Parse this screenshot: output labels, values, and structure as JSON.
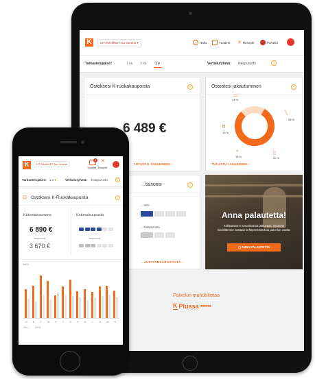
{
  "colors": {
    "brand": "#f26a1b",
    "accent_blue": "#2b4a9e",
    "grey": "#c9c9c9",
    "light_grey": "#e3e3e3"
  },
  "tablet": {
    "nav": {
      "logo": "K",
      "store": "CITYMARKET Iso Omena ▾",
      "items": [
        {
          "label": "Haku",
          "icon": "search-icon"
        },
        {
          "label": "Tuotteet",
          "icon": "cart-icon"
        },
        {
          "label": "Reseptit",
          "icon": "utensils-icon"
        },
        {
          "label": "Palvelut",
          "icon": "services-icon"
        }
      ]
    },
    "period": {
      "label": "Tarkastelujakso:",
      "options": [
        "1 kk",
        "3 kk",
        "1 v"
      ],
      "selected": "1 v",
      "compare_label": "Vertailuryhmä:",
      "compare_value": "Naapurusto"
    },
    "purchases_card": {
      "title": "Ostoksesi K-ruokakaupoista",
      "amount": "6 489 €",
      "link": "TUTUSTU TARKEMMIN"
    },
    "distribution_card": {
      "title": "Ostostesi jakautuminen",
      "labels": [
        "24 %",
        "28 %",
        "15 %",
        "10 %",
        "20 %"
      ],
      "link": "TUTUSTU TARKEMMIN"
    },
    "domestic_card": {
      "title": "…taisuosi",
      "row1": "…sesi",
      "row2": "…Naapurusto",
      "link": "…AUSTAYMPÄRISTÖSTÄ"
    },
    "feedback": {
      "title": "Anna palautetta!",
      "text": "Kehitämme K-Ostoskassia jatkuvasti. Otamme mielellämme vastaan kehitysehdotuksia palvelun osalta.",
      "button": "ANNA PALAUTETTA"
    },
    "footer": {
      "powered_by": "Palvelun mahdollistaa",
      "brand": "Plussa"
    }
  },
  "phone": {
    "nav": {
      "logo": "K",
      "store": "CITYMARKET Iso Omena",
      "badge": "9",
      "items": [
        "Tuotteet",
        "Reseptit"
      ]
    },
    "period": {
      "label": "Tarkastelujakso:",
      "selected": "1 v",
      "compare_label": "Vertailuryhmä:",
      "compare_value": "Naapurusto"
    },
    "card": {
      "title": "Ostoksesi K-Ruokakaupoista",
      "total_label": "Kokonaissumma",
      "total": "6 890 €",
      "compare_small": "Naapurusto",
      "compare_total": "3 670 €",
      "domestic_label": "Kotimaisuusaste",
      "domestic_compare": "Naapurusto"
    },
    "chart": {
      "top_label": "500 €",
      "months": [
        "H",
        "E",
        "T",
        "M",
        "H",
        "T",
        "K",
        "H",
        "E",
        "L",
        "S",
        "M",
        "H"
      ],
      "year_left": "201…",
      "year_right": "2018"
    }
  },
  "chart_data": {
    "type": "bar",
    "title": "",
    "categories": [
      "H",
      "E",
      "T",
      "M",
      "H",
      "T",
      "K",
      "H",
      "E",
      "L",
      "S",
      "M",
      "H"
    ],
    "series": [
      {
        "values": [
          420,
          470,
          620,
          540,
          330,
          460,
          560,
          390,
          420,
          380,
          460,
          470,
          400
        ]
      },
      {
        "values": [
          280,
          240,
          330,
          270,
          370,
          330,
          320,
          300,
          260,
          300,
          320,
          340,
          310
        ]
      }
    ],
    "ylim": [
      0,
      700
    ],
    "grid": false
  }
}
